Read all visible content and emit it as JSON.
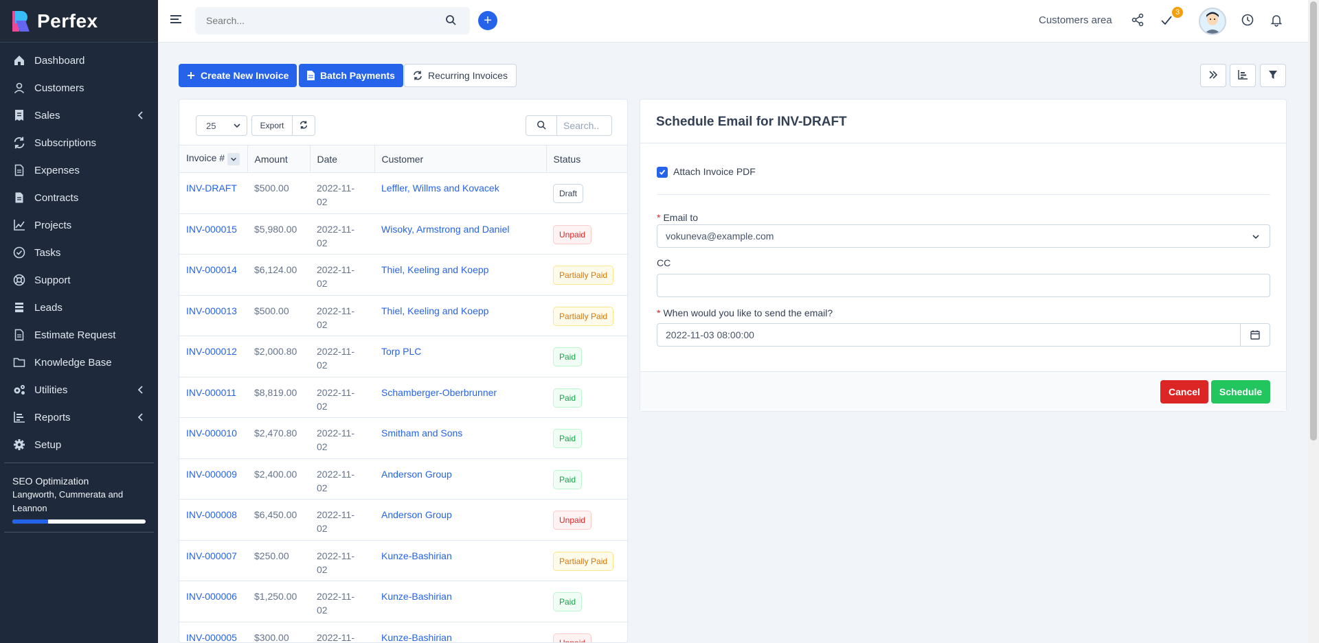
{
  "brand": {
    "name": "Perfex"
  },
  "sidebar": {
    "items": [
      {
        "label": "Dashboard",
        "icon": "home-icon",
        "chevron": false
      },
      {
        "label": "Customers",
        "icon": "user-icon",
        "chevron": false
      },
      {
        "label": "Sales",
        "icon": "receipt-icon",
        "chevron": true
      },
      {
        "label": "Subscriptions",
        "icon": "refresh-icon",
        "chevron": false
      },
      {
        "label": "Expenses",
        "icon": "document-icon",
        "chevron": false
      },
      {
        "label": "Contracts",
        "icon": "contract-icon",
        "chevron": false
      },
      {
        "label": "Projects",
        "icon": "chart-icon",
        "chevron": false
      },
      {
        "label": "Tasks",
        "icon": "check-circle-icon",
        "chevron": false
      },
      {
        "label": "Support",
        "icon": "lifebuoy-icon",
        "chevron": false
      },
      {
        "label": "Leads",
        "icon": "leads-icon",
        "chevron": false
      },
      {
        "label": "Estimate Request",
        "icon": "document-icon",
        "chevron": false
      },
      {
        "label": "Knowledge Base",
        "icon": "folder-icon",
        "chevron": false
      },
      {
        "label": "Utilities",
        "icon": "cogs-icon",
        "chevron": true
      },
      {
        "label": "Reports",
        "icon": "bar-chart-icon",
        "chevron": true
      },
      {
        "label": "Setup",
        "icon": "gear-icon",
        "chevron": false
      }
    ],
    "project": {
      "title": "SEO Optimization",
      "client": "Langworth, Cummerata and Leannon",
      "progress": 0.27
    }
  },
  "topbar": {
    "search_placeholder": "Search...",
    "customers_area": "Customers area",
    "todo_count": "3"
  },
  "actions": {
    "create": "Create New Invoice",
    "batch": "Batch Payments",
    "recurring": "Recurring Invoices"
  },
  "table": {
    "page_length": "25",
    "export": "Export",
    "search_placeholder": "Search..",
    "columns": [
      "Invoice #",
      "Amount",
      "Date",
      "Customer",
      "Status"
    ],
    "rows": [
      {
        "invoice": "INV-DRAFT",
        "amount": "$500.00",
        "date": "2022-11-02",
        "customer": "Leffler, Willms and Kovacek",
        "status": "Draft",
        "status_class": "st-draft"
      },
      {
        "invoice": "INV-000015",
        "amount": "$5,980.00",
        "date": "2022-11-02",
        "customer": "Wisoky, Armstrong and Daniel",
        "status": "Unpaid",
        "status_class": "st-unpaid"
      },
      {
        "invoice": "INV-000014",
        "amount": "$6,124.00",
        "date": "2022-11-02",
        "customer": "Thiel, Keeling and Koepp",
        "status": "Partially Paid",
        "status_class": "st-partial"
      },
      {
        "invoice": "INV-000013",
        "amount": "$500.00",
        "date": "2022-11-02",
        "customer": "Thiel, Keeling and Koepp",
        "status": "Partially Paid",
        "status_class": "st-partial"
      },
      {
        "invoice": "INV-000012",
        "amount": "$2,000.80",
        "date": "2022-11-02",
        "customer": "Torp PLC",
        "status": "Paid",
        "status_class": "st-paid"
      },
      {
        "invoice": "INV-000011",
        "amount": "$8,819.00",
        "date": "2022-11-02",
        "customer": "Schamberger-Oberbrunner",
        "status": "Paid",
        "status_class": "st-paid"
      },
      {
        "invoice": "INV-000010",
        "amount": "$2,470.80",
        "date": "2022-11-02",
        "customer": "Smitham and Sons",
        "status": "Paid",
        "status_class": "st-paid"
      },
      {
        "invoice": "INV-000009",
        "amount": "$2,400.00",
        "date": "2022-11-02",
        "customer": "Anderson Group",
        "status": "Paid",
        "status_class": "st-paid"
      },
      {
        "invoice": "INV-000008",
        "amount": "$6,450.00",
        "date": "2022-11-02",
        "customer": "Anderson Group",
        "status": "Unpaid",
        "status_class": "st-unpaid"
      },
      {
        "invoice": "INV-000007",
        "amount": "$250.00",
        "date": "2022-11-02",
        "customer": "Kunze-Bashirian",
        "status": "Partially Paid",
        "status_class": "st-partial"
      },
      {
        "invoice": "INV-000006",
        "amount": "$1,250.00",
        "date": "2022-11-02",
        "customer": "Kunze-Bashirian",
        "status": "Paid",
        "status_class": "st-paid"
      },
      {
        "invoice": "INV-000005",
        "amount": "$300.00",
        "date": "2022-11-",
        "customer": "Kunze-Bashirian",
        "status": "Unpaid",
        "status_class": "st-unpaid"
      }
    ]
  },
  "schedule": {
    "title": "Schedule Email for INV-DRAFT",
    "attach_label": "Attach Invoice PDF",
    "attach_checked": true,
    "email_label": "Email to",
    "email_value": "vokuneva@example.com",
    "cc_label": "CC",
    "cc_value": "",
    "when_label": "When would you like to send the email?",
    "when_value": "2022-11-03 08:00:00",
    "cancel": "Cancel",
    "submit": "Schedule"
  },
  "colors": {
    "primary": "#2563eb",
    "sidebar": "#1e293b",
    "danger": "#dc2626",
    "success": "#22c55e"
  }
}
